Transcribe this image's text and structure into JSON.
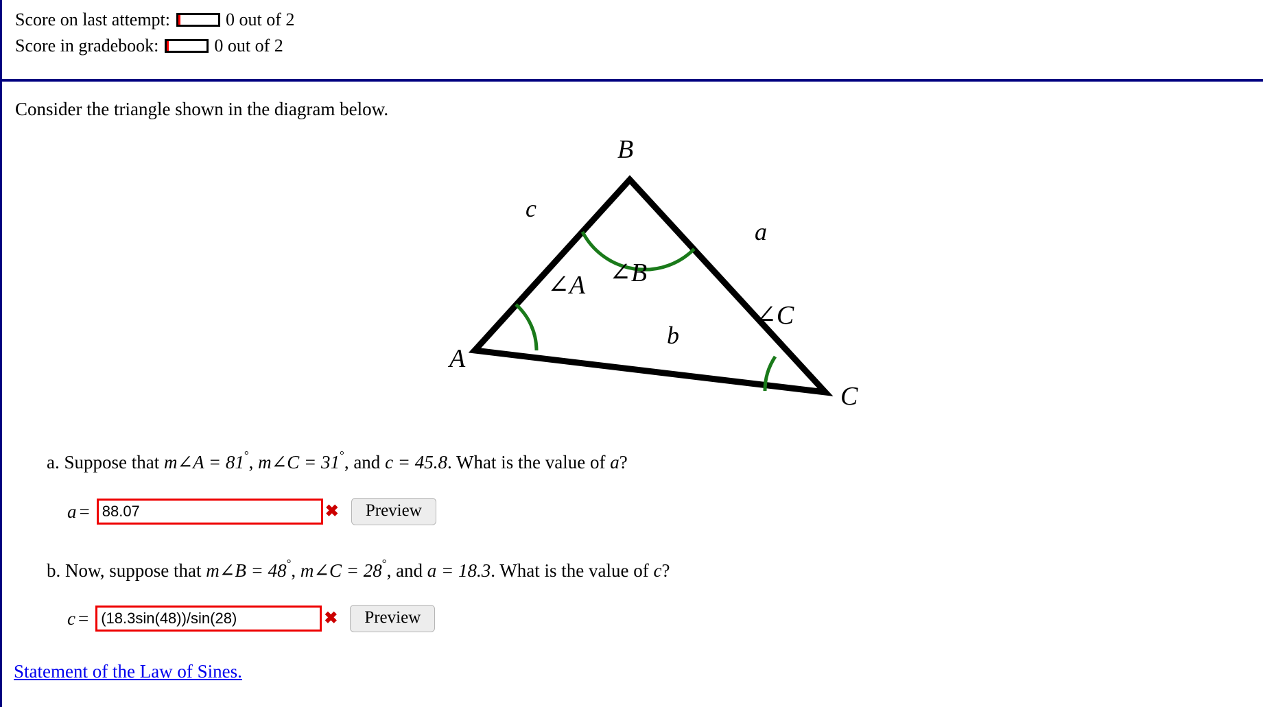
{
  "header": {
    "last_attempt_label": "Score on last attempt:",
    "gradebook_label": "Score in gradebook:",
    "last_attempt_value": "0 out of 2",
    "gradebook_value": "0 out of 2",
    "progress_percent": 0,
    "max_score": 2,
    "divider_color": "#000080"
  },
  "prompt": "Consider the triangle shown in the diagram below.",
  "figure": {
    "vertex_a_label": "A",
    "vertex_b_label": "B",
    "vertex_c_label": "C",
    "side_a_label": "a",
    "side_b_label": "b",
    "side_c_label": "c",
    "angle_a_label": "∠A",
    "angle_b_label": "∠B",
    "angle_c_label": "∠C",
    "arc_color": "#1a7a1a",
    "stroke_color": "#000000"
  },
  "part_a": {
    "marker": "a.",
    "text_1": "Suppose that ",
    "given_1": "m∠A = 81",
    "degree": "°",
    "text_2": ", ",
    "given_2": "m∠C = 31",
    "text_3": ", and ",
    "given_3": "c = 45.8",
    "text_4": ". What is the value of ",
    "unknown": "a",
    "text_5": "?",
    "angle_A": 81,
    "angle_C": 31,
    "side_c": 45.8,
    "solve_for": "a"
  },
  "part_b": {
    "marker": "b.",
    "text_1": "Now, suppose that ",
    "given_1": "m∠B = 48",
    "degree": "°",
    "text_2": ", ",
    "given_2": "m∠C = 28",
    "text_3": ", and ",
    "given_3": "a = 18.3",
    "text_4": ". What is the value of ",
    "unknown": "c",
    "text_5": "?",
    "angle_B": 48,
    "angle_C": 28,
    "side_a": 18.3,
    "solve_for": "c"
  },
  "answer_a": {
    "variable": "a",
    "equals": "=",
    "value": "88.07",
    "placeholder": "",
    "status_icon": "✖",
    "status": "incorrect",
    "preview_label": "Preview",
    "border_color": "#ee0000"
  },
  "answer_b": {
    "variable": "c",
    "equals": "=",
    "value": "(18.3sin(48))/sin(28)",
    "placeholder": "",
    "status_icon": "✖",
    "status": "incorrect",
    "preview_label": "Preview",
    "border_color": "#ee0000"
  },
  "footer": {
    "link_label": "Statement of the Law of Sines.",
    "link_color": "#0000ee"
  }
}
